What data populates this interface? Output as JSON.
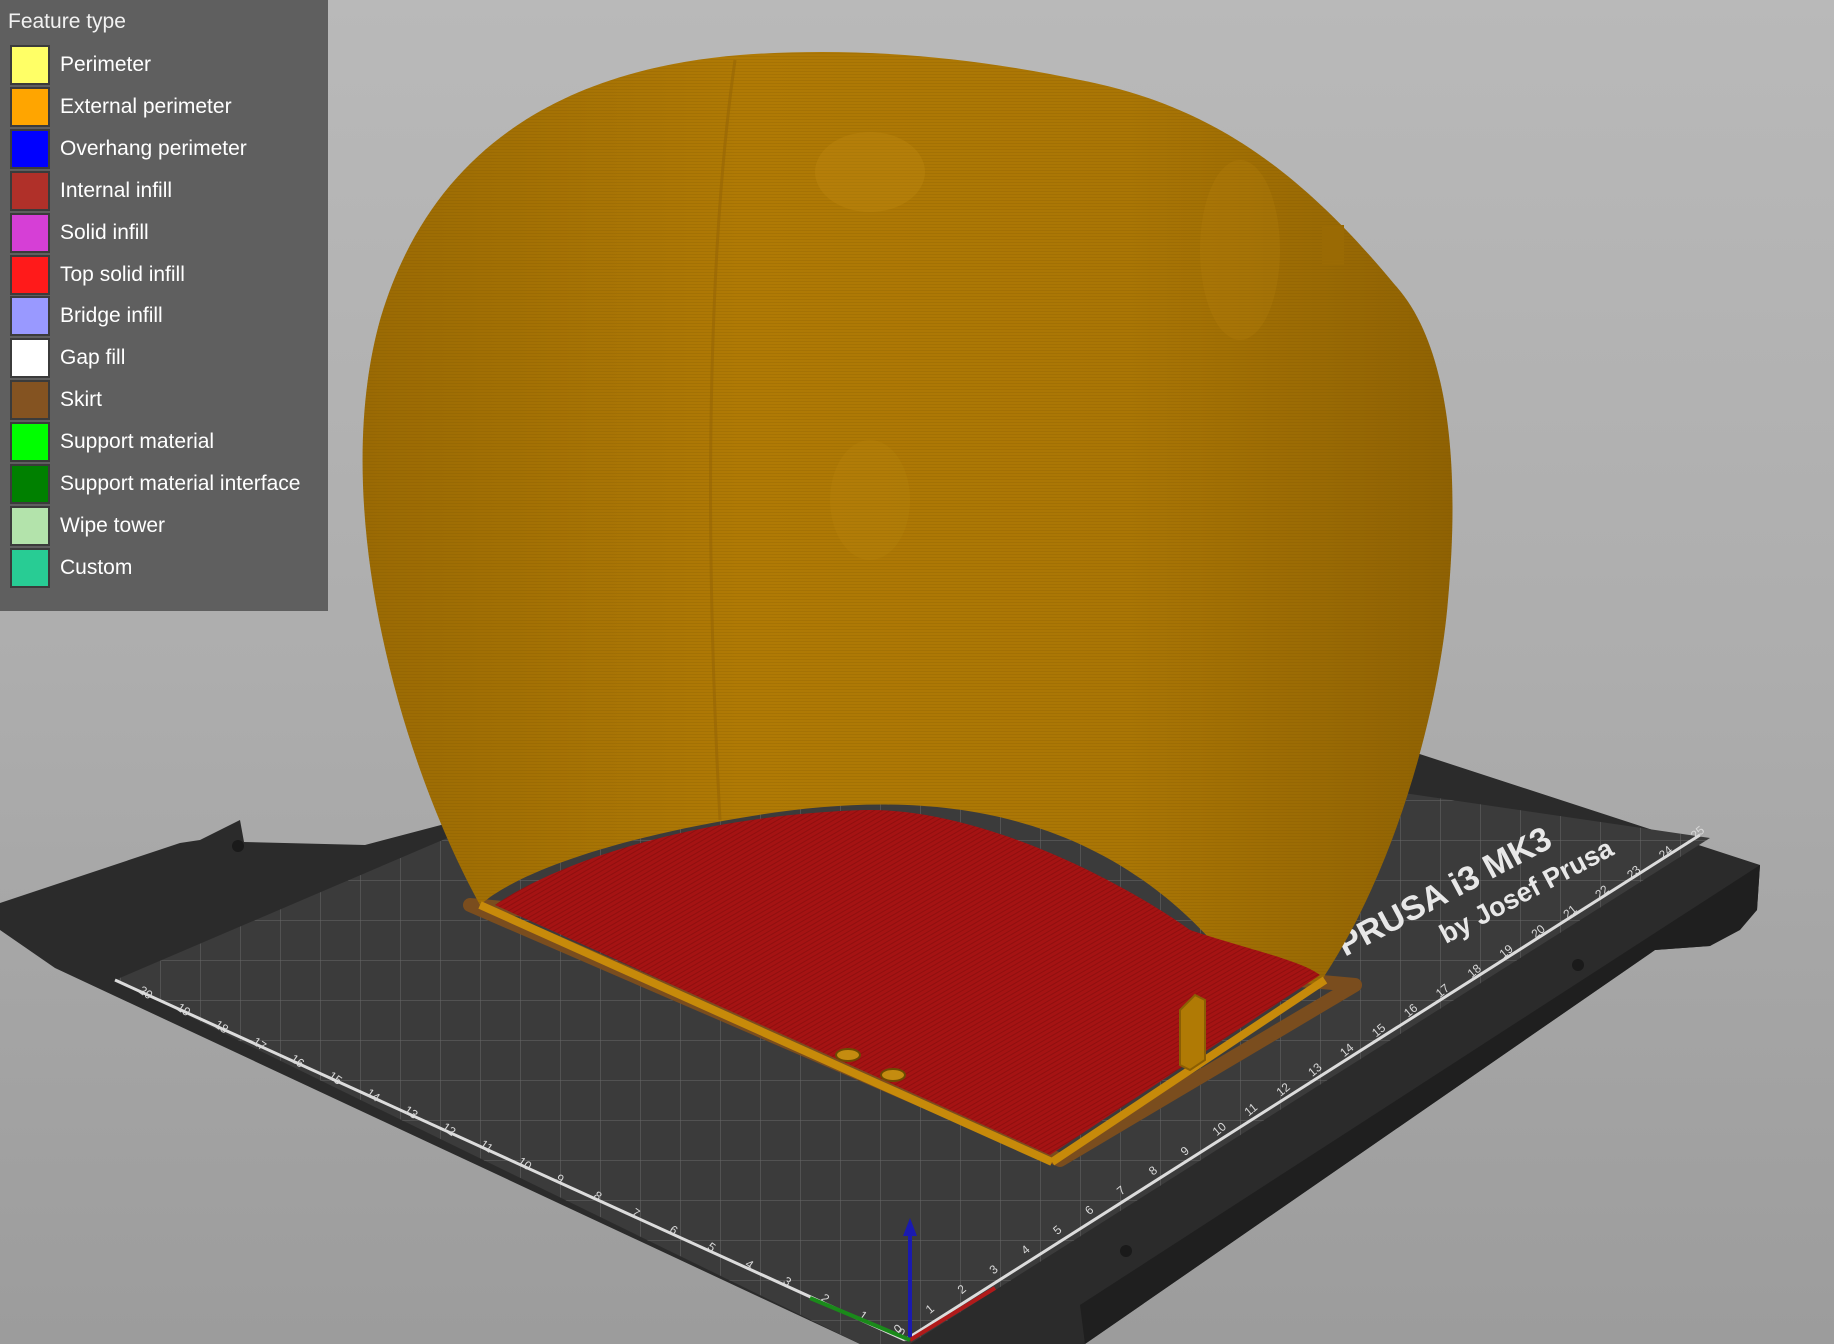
{
  "legend": {
    "title": "Feature type",
    "items": [
      {
        "label": "Perimeter",
        "color": "#ffff66"
      },
      {
        "label": "External perimeter",
        "color": "#ffa500"
      },
      {
        "label": "Overhang perimeter",
        "color": "#0000ff"
      },
      {
        "label": "Internal infill",
        "color": "#b03029"
      },
      {
        "label": "Solid infill",
        "color": "#d63fd6"
      },
      {
        "label": "Top solid infill",
        "color": "#ff1a1a"
      },
      {
        "label": "Bridge infill",
        "color": "#9999ff"
      },
      {
        "label": "Gap fill",
        "color": "#ffffff"
      },
      {
        "label": "Skirt",
        "color": "#845321"
      },
      {
        "label": "Support material",
        "color": "#00ff00"
      },
      {
        "label": "Support material interface",
        "color": "#008000"
      },
      {
        "label": "Wipe tower",
        "color": "#b3e3ab"
      },
      {
        "label": "Custom",
        "color": "#28cc94"
      }
    ]
  },
  "bed": {
    "logo_line1": "PRUSA i3 MK3",
    "logo_line2": "by Josef Prusa",
    "left_scale": [
      "20",
      "19",
      "18",
      "17",
      "16",
      "15",
      "14",
      "13",
      "12",
      "11",
      "10",
      "9",
      "8",
      "7",
      "6",
      "5",
      "4",
      "3",
      "2",
      "1",
      "0"
    ],
    "right_scale": [
      "0",
      "1",
      "2",
      "3",
      "4",
      "5",
      "6",
      "7",
      "8",
      "9",
      "10",
      "11",
      "12",
      "13",
      "14",
      "15",
      "16",
      "17",
      "18",
      "19",
      "20",
      "21",
      "22",
      "23",
      "24",
      "25"
    ]
  },
  "colors": {
    "model_external_perimeter": "#b07a05",
    "top_solid_infill": "#a81212",
    "bed_dark": "#2e2e2e",
    "bed_sheet": "#3a3a3a"
  }
}
